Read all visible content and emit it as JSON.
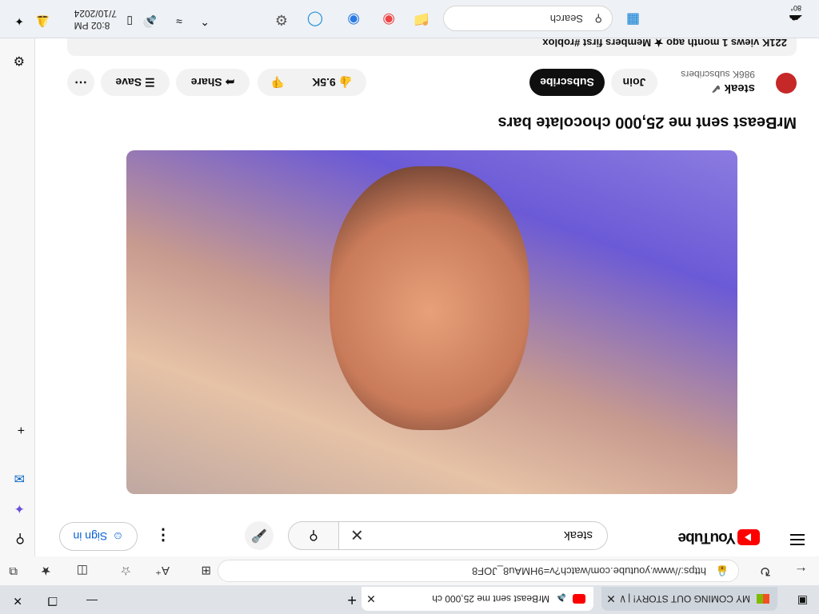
{
  "browser": {
    "tabs": [
      {
        "title": "MY COMING OUT STORY! | Wat"
      },
      {
        "title": "MrBeast sent me 25,000 ch"
      }
    ],
    "url": "https://www.youtube.com/watch?v=9HMAu8_JOF8"
  },
  "youtube": {
    "logo": "YouTube",
    "search_value": "steak",
    "sign_in": "Sign in",
    "video_title": "MrBeast sent me 25,000 chocolate bars",
    "channel": {
      "name": "steak",
      "subscribers": "986K subscribers"
    },
    "buttons": {
      "join": "Join",
      "subscribe": "Subscribe",
      "likes": "9.5K",
      "share": "Share",
      "save": "Save"
    },
    "description_meta": "221K views  1 month ago  ★ Members first  #roblox"
  },
  "taskbar": {
    "search": "Search",
    "time": "8:02 PM",
    "date": "7/10/2024",
    "weather": "80°"
  }
}
